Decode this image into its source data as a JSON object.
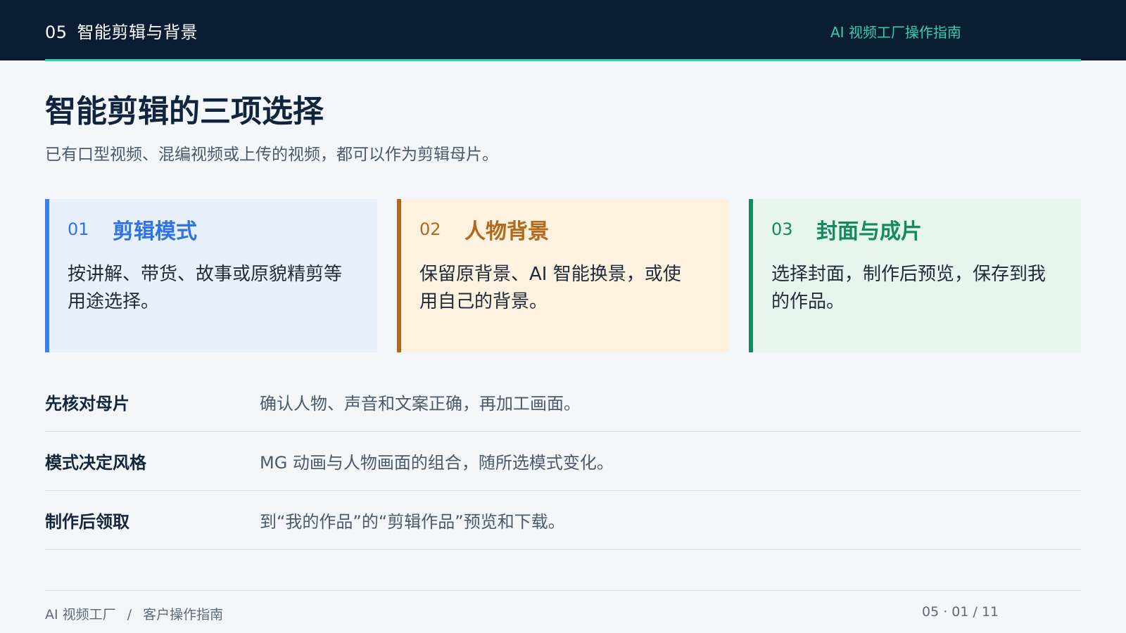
{
  "header": {
    "section_number": "05",
    "section_title": "智能剪辑与背景",
    "brand": "AI 视频工厂操作指南"
  },
  "main": {
    "title": "智能剪辑的三项选择",
    "subtitle": "已有口型视频、混编视频或上传的视频，都可以作为剪辑母片。"
  },
  "cards": [
    {
      "number": "01",
      "title": "剪辑模式",
      "body_lines": [
        "按讲解、带货、故事或原貌精剪等",
        "用途选择。"
      ],
      "accent_color": "#3b7ded"
    },
    {
      "number": "02",
      "title": "人物背景",
      "body_lines": [
        "保留原背景、AI 智能换景，或使",
        "用自己的背景。"
      ],
      "accent_color": "#b3691b"
    },
    {
      "number": "03",
      "title": "封面与成片",
      "body_lines": [
        "选择封面，制作后预览，保存到我",
        "的作品。"
      ],
      "accent_color": "#138a60"
    }
  ],
  "notes": [
    {
      "label": "先核对母片",
      "text": "确认人物、声音和文案正确，再加工画面。"
    },
    {
      "label": "模式决定风格",
      "text": "MG 动画与人物画面的组合，随所选模式变化。"
    },
    {
      "label": "制作后领取",
      "text": "到“我的作品”的“剪辑作品”预览和下载。"
    }
  ],
  "footer": {
    "product": "AI 视频工厂",
    "separator": "/",
    "doc": "客户操作指南",
    "page_indicator": "05 · 01 / 11"
  },
  "colors": {
    "header_bg": "#0b1d33",
    "accent": "#2ed1b0"
  }
}
